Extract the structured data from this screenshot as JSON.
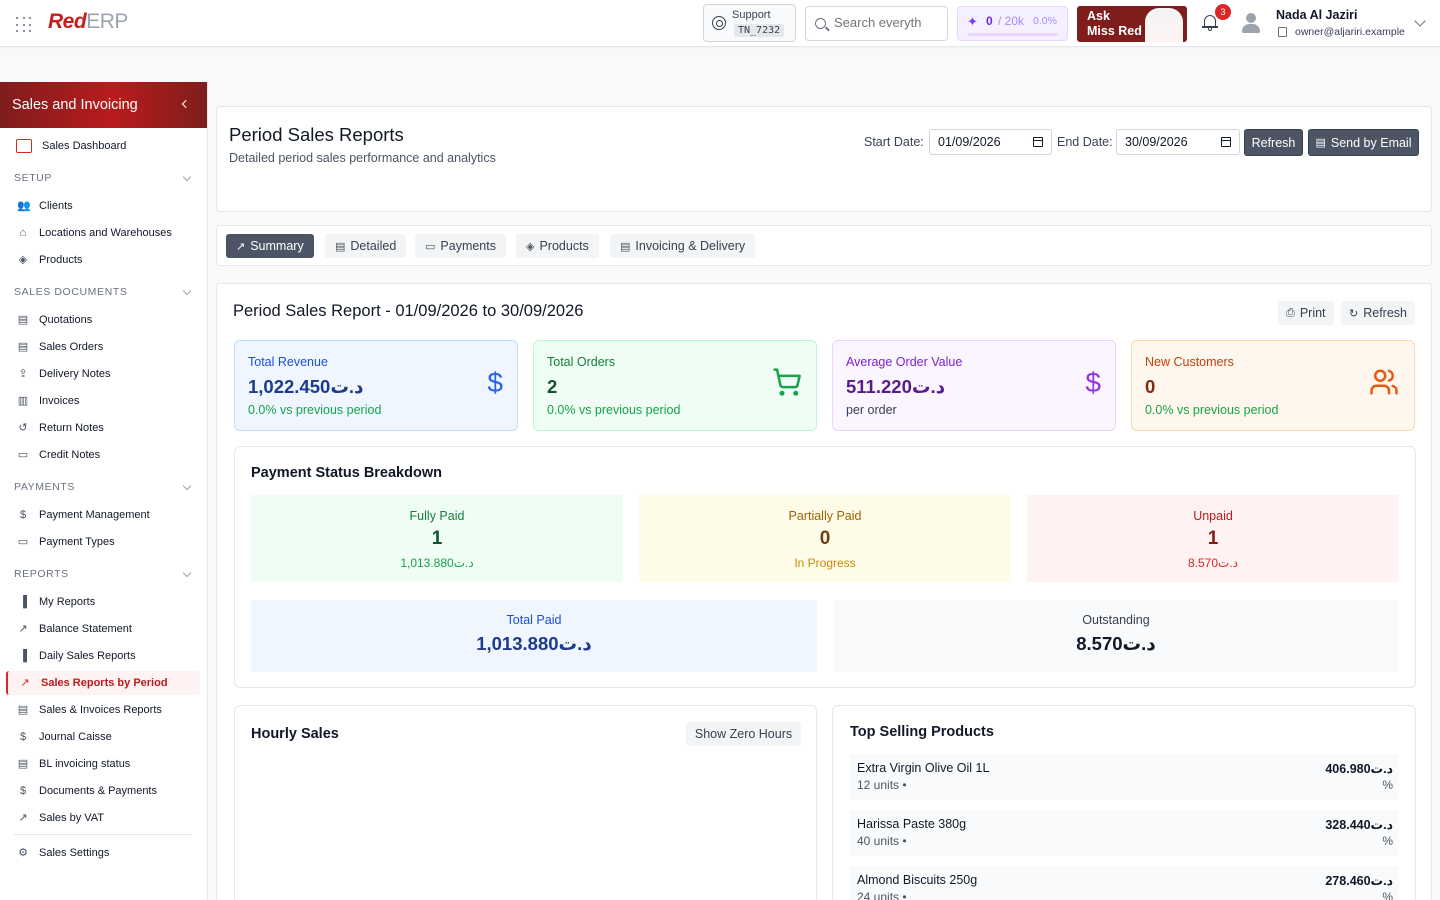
{
  "topbar": {
    "logo_red": "Red",
    "logo_erp": "ERP",
    "support_label": "Support",
    "support_code": "TN_7232",
    "search_placeholder": "Search everyth",
    "ai_used": "0",
    "ai_max": "/ 20k",
    "ai_pct": "0.0%",
    "ask_line1": "Ask",
    "ask_line2": "Miss Red",
    "notif_count": "3",
    "user_name": "Nada Al Jaziri",
    "user_email": "owner@aljariri.example"
  },
  "sidebar": {
    "title": "Sales and Invoicing",
    "dashboard": "Sales Dashboard",
    "sections": {
      "setup": "SETUP",
      "sales_documents": "SALES DOCUMENTS",
      "payments": "PAYMENTS",
      "reports": "REPORTS"
    },
    "setup_items": [
      "Clients",
      "Locations and Warehouses",
      "Products"
    ],
    "document_items": [
      "Quotations",
      "Sales Orders",
      "Delivery Notes",
      "Invoices",
      "Return Notes",
      "Credit Notes"
    ],
    "payment_items": [
      "Payment Management",
      "Payment Types"
    ],
    "report_items": [
      "My Reports",
      "Balance Statement",
      "Daily Sales Reports",
      "Sales Reports by Period",
      "Sales & Invoices Reports",
      "Journal Caisse",
      "BL invoicing status",
      "Documents & Payments",
      "Sales by VAT"
    ],
    "settings": "Sales Settings"
  },
  "header": {
    "title": "Period Sales Reports",
    "subtitle": "Detailed period sales performance and analytics",
    "start_label": "Start Date:",
    "start_value": "01/09/2026",
    "end_label": "End Date:",
    "end_value": "30/09/2026",
    "refresh_label": "Refresh",
    "email_label": "Send by Email"
  },
  "tabs": [
    "Summary",
    "Detailed",
    "Payments",
    "Products",
    "Invoicing & Delivery"
  ],
  "report": {
    "title": "Period Sales Report - 01/09/2026 to 30/09/2026",
    "print_label": "Print",
    "refresh_label": "Refresh",
    "kpis": [
      {
        "label": "Total Revenue",
        "value": "1,022.450د.ت",
        "sub": "0.0% vs previous period",
        "color": "#2563eb"
      },
      {
        "label": "Total Orders",
        "value": "2",
        "sub": "0.0% vs previous period",
        "color": "#16a34a"
      },
      {
        "label": "Average Order Value",
        "value": "511.220د.ت",
        "sub": "per order",
        "color": "#9333ea"
      },
      {
        "label": "New Customers",
        "value": "0",
        "sub": "0.0% vs previous period",
        "color": "#ea580c"
      }
    ],
    "payment": {
      "title": "Payment Status Breakdown",
      "fully_label": "Fully Paid",
      "fully_count": "1",
      "fully_amount": "1,013.880د.ت",
      "partial_label": "Partially Paid",
      "partial_count": "0",
      "partial_sub": "In Progress",
      "unpaid_label": "Unpaid",
      "unpaid_count": "1",
      "unpaid_amount": "8.570د.ت",
      "total_paid_label": "Total Paid",
      "total_paid_value": "1,013.880د.ت",
      "outstanding_label": "Outstanding",
      "outstanding_value": "8.570د.ت"
    },
    "hourly": {
      "title": "Hourly Sales",
      "zero_button": "Show Zero Hours"
    },
    "top_products": {
      "title": "Top Selling Products",
      "items": [
        {
          "name": "Extra Virgin Olive Oil 1L",
          "units": "12 units •",
          "value": "406.980د.ت",
          "pct": "%"
        },
        {
          "name": "Harissa Paste 380g",
          "units": "40 units •",
          "value": "328.440د.ت",
          "pct": "%"
        },
        {
          "name": "Almond Biscuits 250g",
          "units": "24 units •",
          "value": "278.460د.ت",
          "pct": "%"
        }
      ]
    }
  }
}
